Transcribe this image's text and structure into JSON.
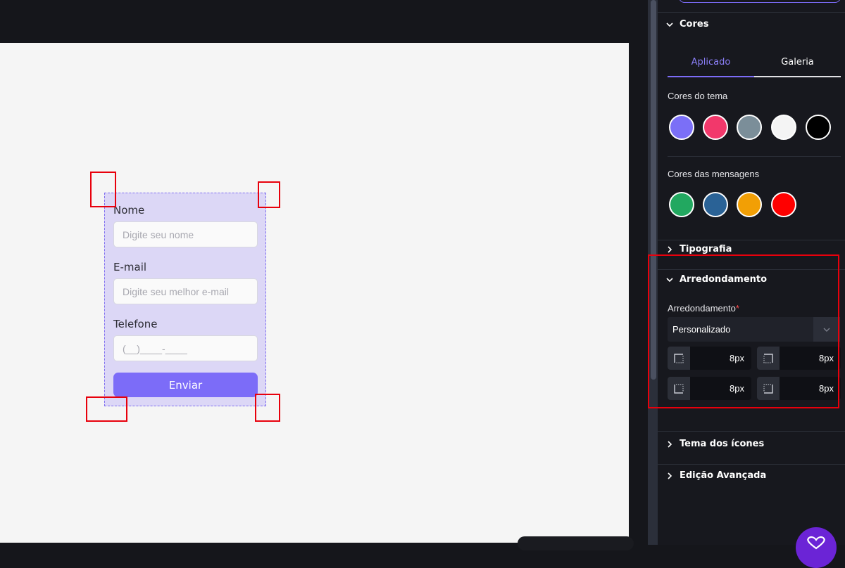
{
  "form": {
    "name_label": "Nome",
    "name_placeholder": "Digite seu nome",
    "email_label": "E-mail",
    "email_placeholder": "Digite seu melhor e-mail",
    "phone_label": "Telefone",
    "phone_placeholder": "(__)____-____",
    "submit_label": "Enviar"
  },
  "panel": {
    "colors_section": {
      "title": "Cores",
      "tabs": [
        "Aplicado",
        "Galeria"
      ],
      "active_tab": "Aplicado",
      "theme_label": "Cores do tema",
      "theme_colors": [
        "#7b6ff7",
        "#f2386b",
        "#7b8e99",
        "#f4f4f4",
        "#000000"
      ],
      "message_label": "Cores das mensagens",
      "message_colors": [
        "#22a860",
        "#2a6296",
        "#f29f05",
        "#ff0000"
      ]
    },
    "typography_title": "Tipografia",
    "rounding_section": {
      "title": "Arredondamento",
      "field_label": "Arredondamento",
      "required_mark": "*",
      "select_value": "Personalizado",
      "corners": {
        "top_left": "8px",
        "top_right": "8px",
        "bottom_left": "8px",
        "bottom_right": "8px"
      }
    },
    "icons_theme_title": "Tema dos ícones",
    "advanced_title": "Edição Avançada"
  },
  "colors": {
    "accent": "#7c6cf8",
    "highlight": "#e8000c"
  }
}
